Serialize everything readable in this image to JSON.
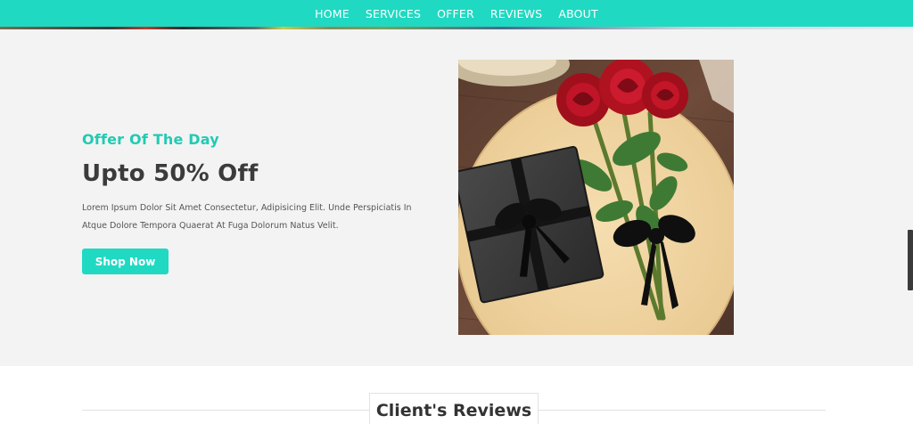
{
  "nav": {
    "links": [
      {
        "label": "HOME"
      },
      {
        "label": "SERVICES"
      },
      {
        "label": "OFFER"
      },
      {
        "label": "REVIEWS"
      },
      {
        "label": "ABOUT"
      }
    ]
  },
  "offer": {
    "subtitle": "Offer Of The Day",
    "title": "Upto 50% Off",
    "description": "Lorem Ipsum Dolor Sit Amet Consectetur, Adipisicing Elit. Unde Perspiciatis In Atque Dolore Tempora Quaerat At Fuga Dolorum Natus Velit.",
    "button_label": "Shop Now"
  },
  "reviews": {
    "heading": "Client's Reviews"
  },
  "colors": {
    "accent": "#20d9c2",
    "offer_bg": "#f3f3f3",
    "heading_text": "#3b3b3b"
  }
}
